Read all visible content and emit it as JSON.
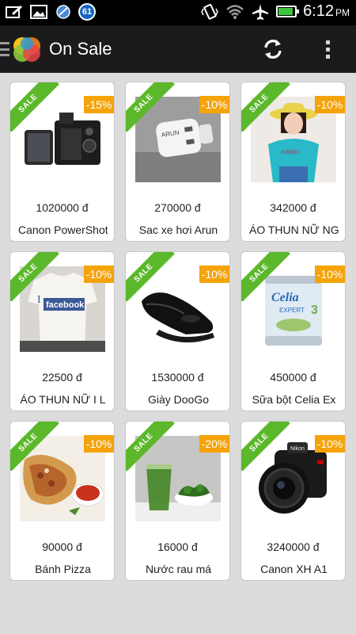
{
  "status_bar": {
    "notification_count": "61",
    "time": "6:12",
    "ampm": "PM",
    "battery_level": 0.9
  },
  "action_bar": {
    "title": "On Sale"
  },
  "products": [
    {
      "ribbon": "SALE",
      "discount": "-15%",
      "price": "1020000 đ",
      "name": "Canon PowerShot"
    },
    {
      "ribbon": "SALE",
      "discount": "-10%",
      "price": "270000 đ",
      "name": "Sac xe hơi Arun"
    },
    {
      "ribbon": "SALE",
      "discount": "-10%",
      "price": "342000 đ",
      "name": "ÁO THUN NỮ NG"
    },
    {
      "ribbon": "SALE",
      "discount": "-10%",
      "price": "22500 đ",
      "name": "ÁO THUN NỮ I L"
    },
    {
      "ribbon": "SALE",
      "discount": "-10%",
      "price": "1530000 đ",
      "name": "Giày DooGo"
    },
    {
      "ribbon": "SALE",
      "discount": "-10%",
      "price": "450000 đ",
      "name": "Sữa bột Celia Ex"
    },
    {
      "ribbon": "SALE",
      "discount": "-10%",
      "price": "90000 đ",
      "name": "Bánh Pizza"
    },
    {
      "ribbon": "SALE",
      "discount": "-20%",
      "price": "16000 đ",
      "name": "Nước rau má"
    },
    {
      "ribbon": "SALE",
      "discount": "-10%",
      "price": "3240000 đ",
      "name": "Canon XH A1"
    }
  ],
  "thumb_text": {
    "charger_brand": "ARUN",
    "shirt_logo": "facebook",
    "shirt_prefix": "I",
    "milk_brand": "Celia",
    "milk_line": "EXPERT",
    "camera_brand": "Nikon"
  },
  "colors": {
    "sale_ribbon": "#5cb82b",
    "discount_badge": "#f5a30a",
    "action_bar": "#1b1b1b",
    "background": "#dcdcdc"
  },
  "icons": [
    "drawer-icon",
    "app-logo-icon",
    "refresh-icon",
    "overflow-menu-icon"
  ]
}
